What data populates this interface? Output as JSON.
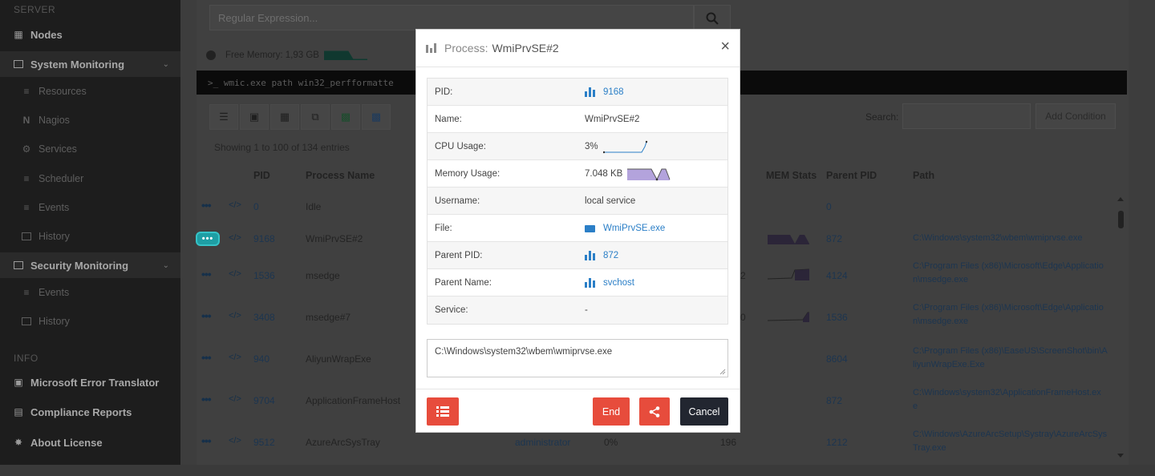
{
  "sidebar": {
    "server_header": "SERVER",
    "info_header": "INFO",
    "items": [
      {
        "label": "Nodes",
        "icon": "sitemap-icon"
      },
      {
        "label": "System Monitoring",
        "icon": "monitor-icon"
      },
      {
        "label": "Resources",
        "icon": "list-icon"
      },
      {
        "label": "Nagios",
        "icon": "nagios-icon"
      },
      {
        "label": "Services",
        "icon": "gear-icon"
      },
      {
        "label": "Scheduler",
        "icon": "list-icon"
      },
      {
        "label": "Events",
        "icon": "list-icon"
      },
      {
        "label": "History",
        "icon": "book-icon"
      },
      {
        "label": "Security Monitoring",
        "icon": "monitor-icon"
      },
      {
        "label": "Events",
        "icon": "list-icon"
      },
      {
        "label": "History",
        "icon": "book-icon"
      },
      {
        "label": "Microsoft Error Translator",
        "icon": "puzzle-icon"
      },
      {
        "label": "Compliance Reports",
        "icon": "document-icon"
      },
      {
        "label": "About License",
        "icon": "certificate-icon"
      }
    ]
  },
  "main": {
    "regex_placeholder": "Regular Expression...",
    "free_memory": "Free Memory: 1,93 GB",
    "command": ">_  wmic.exe path win32_perfformatte",
    "search_label": "Search:",
    "add_condition": "Add Condition",
    "showing": "Showing 1 to 100 of 134 entries",
    "columns": {
      "pid": "PID",
      "process_name": "Process Name",
      "mem_stats": "MEM Stats",
      "parent_pid": "Parent PID",
      "path": "Path"
    },
    "rows": [
      {
        "pid": "0",
        "name": "Idle",
        "c1": "",
        "c2": "",
        "parent": "0",
        "path": ""
      },
      {
        "pid": "9168",
        "name": "WmiPrvSE#2",
        "c1": "",
        "c2": "",
        "parent": "872",
        "path": "C:\\Windows\\system32\\wbem\\wmiprvse.exe"
      },
      {
        "pid": "1536",
        "name": "msedge",
        "c1": "",
        "c2": "2",
        "parent": "4124",
        "path": "C:\\Program Files (x86)\\Microsoft\\Edge\\Applicatio",
        "path2": "n\\msedge.exe"
      },
      {
        "pid": "3408",
        "name": "msedge#7",
        "c1": "",
        "c2": "0",
        "parent": "1536",
        "path": "C:\\Program Files (x86)\\Microsoft\\Edge\\Applicatio",
        "path2": "n\\msedge.exe"
      },
      {
        "pid": "940",
        "name": "AliyunWrapExe",
        "c1": "",
        "c2": "",
        "parent": "8604",
        "path": "C:\\Program Files (x86)\\EaseUS\\ScreenShot\\bin\\A",
        "path2": "liyunWrapExe.Exe"
      },
      {
        "pid": "9704",
        "name": "ApplicationFrameHost",
        "c1": "",
        "c2": "",
        "parent": "872",
        "path": "C:\\Windows\\system32\\ApplicationFrameHost.ex",
        "path2": "e"
      },
      {
        "pid": "9512",
        "name": "AzureArcSysTray",
        "c1": "administrator",
        "cpu": "0%",
        "c2": "196",
        "parent": "1212",
        "path": "C:\\Windows\\AzureArcSetup\\Systray\\AzureArcSys",
        "path2": "Tray.exe"
      }
    ]
  },
  "modal": {
    "title_prefix": "Process:",
    "title_name": "WmiPrvSE#2",
    "close": "×",
    "fields": [
      {
        "label": "PID:",
        "value": "9168"
      },
      {
        "label": "Name:",
        "value": "WmiPrvSE#2"
      },
      {
        "label": "CPU Usage:",
        "value": "3%"
      },
      {
        "label": "Memory Usage:",
        "value": "7.048 KB"
      },
      {
        "label": "Username:",
        "value": "local service"
      },
      {
        "label": "File:",
        "value": "WmiPrvSE.exe"
      },
      {
        "label": "Parent PID:",
        "value": "872"
      },
      {
        "label": "Parent Name:",
        "value": "svchost"
      },
      {
        "label": "Service:",
        "value": "-"
      }
    ],
    "path_value": "C:\\Windows\\system32\\wbem\\wmiprvse.exe",
    "buttons": {
      "end": "End",
      "cancel": "Cancel"
    }
  },
  "colors": {
    "accent_blue": "#2b7fc7",
    "danger": "#e74c3c",
    "dark_button": "#222630",
    "highlight": "#1e9ea4"
  }
}
